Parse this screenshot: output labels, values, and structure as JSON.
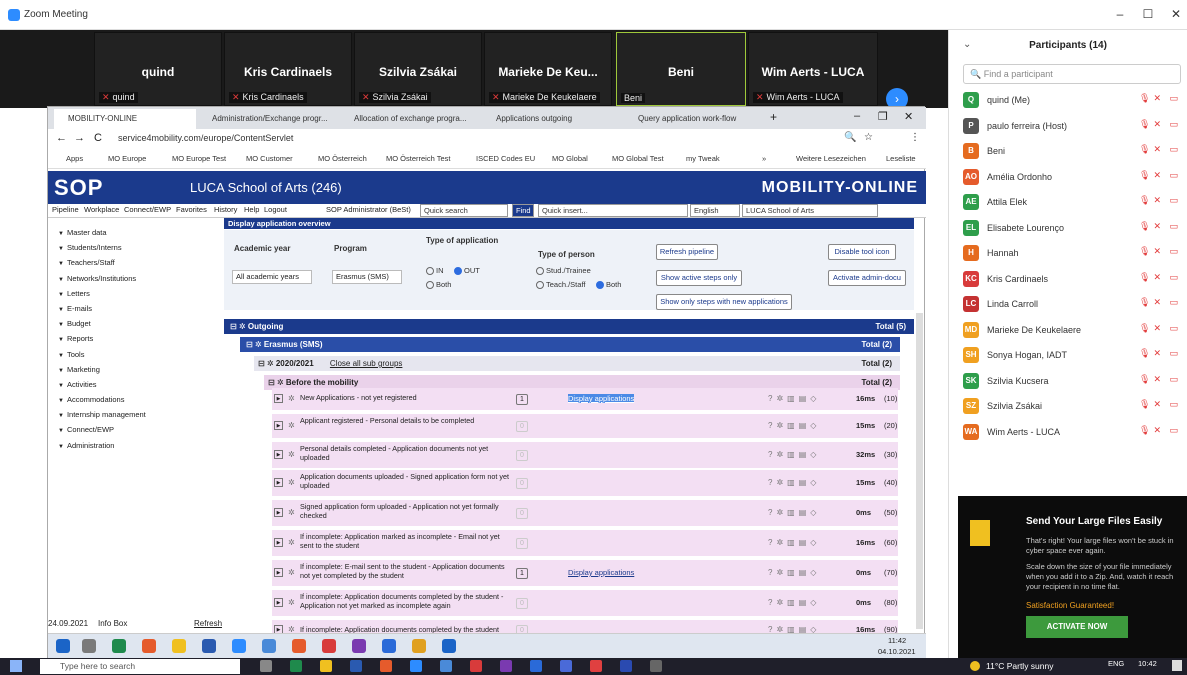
{
  "zoom": {
    "title": "Zoom Meeting"
  },
  "video_strip": {
    "tiles": [
      {
        "big": "quind",
        "small": "quind",
        "muted": true
      },
      {
        "big": "Kris Cardinaels",
        "small": "Kris Cardinaels",
        "muted": true
      },
      {
        "big": "Szilvia Zsákai",
        "small": "Szilvia Zsákai",
        "muted": true
      },
      {
        "big": "Marieke De Keu...",
        "small": "Marieke De Keukelaere",
        "muted": true
      },
      {
        "big": "Beni",
        "small": "Beni",
        "muted": false
      },
      {
        "big": "Wim Aerts - LUCA",
        "small": "Wim Aerts - LUCA",
        "muted": true
      }
    ]
  },
  "participants": {
    "title": "Participants (14)",
    "find_placeholder": "Find a participant",
    "list": [
      {
        "initials": "Q",
        "name": "quind (Me)",
        "color": "#2e9e4b"
      },
      {
        "initials": "P",
        "name": "paulo ferreira (Host)",
        "color": "#555555"
      },
      {
        "initials": "B",
        "name": "Beni",
        "color": "#e56b1f"
      },
      {
        "initials": "AO",
        "name": "Amélia Ordonho",
        "color": "#e55b2c"
      },
      {
        "initials": "AE",
        "name": "Attila Elek",
        "color": "#2e9e4b"
      },
      {
        "initials": "EL",
        "name": "Elisabete Lourenço",
        "color": "#2e9e4b"
      },
      {
        "initials": "H",
        "name": "Hannah",
        "color": "#e56b1f"
      },
      {
        "initials": "KC",
        "name": "Kris Cardinaels",
        "color": "#d83b3b"
      },
      {
        "initials": "LC",
        "name": "Linda Carroll",
        "color": "#c43232"
      },
      {
        "initials": "MD",
        "name": "Marieke De Keukelaere",
        "color": "#f0a020"
      },
      {
        "initials": "SH",
        "name": "Sonya Hogan, IADT",
        "color": "#f0a020"
      },
      {
        "initials": "SK",
        "name": "Szilvia Kucsera",
        "color": "#2e9e4b"
      },
      {
        "initials": "SZ",
        "name": "Szilvia Zsákai",
        "color": "#f0a020"
      },
      {
        "initials": "WA",
        "name": "Wim Aerts - LUCA",
        "color": "#e56b1f"
      }
    ]
  },
  "ad": {
    "title": "Send Your Large Files Easily",
    "text1": "That's right! Your large files won't be stuck in cyber space ever again.",
    "text2": "Scale down the size of your file immediately when you add it to a Zip. And, watch it reach your recipient in no time flat.",
    "satisfaction": "Satisfaction Guaranteed!",
    "button": "ACTIVATE NOW"
  },
  "browser": {
    "tabs": [
      "MOBILITY-ONLINE",
      "Administration/Exchange progr...",
      "Allocation of exchange progra...",
      "Applications outgoing",
      "Query application work-flow"
    ],
    "url": "service4mobility.com/europe/ContentServlet",
    "bookmarks": [
      "Apps",
      "MO Europe",
      "MO Europe Test",
      "MO Customer",
      "MO Österreich",
      "MO Österreich Test",
      "ISCED Codes EU",
      "MO Global",
      "MO Global Test",
      "my Tweak",
      "»",
      "Weitere Lesezeichen",
      "Leseliste"
    ]
  },
  "sop": {
    "logo": "SOP",
    "school": "LUCA School of Arts (246)",
    "brand": "MOBILITY-ONLINE",
    "menu": [
      "Pipeline",
      "Workplace",
      "Connect/EWP",
      "Favorites",
      "History",
      "Help",
      "Logout"
    ],
    "user": "SOP Administrator (BeSt)",
    "quick_search": "Quick search",
    "find": "Find",
    "quick_insert": "Quick insert...",
    "language": "English",
    "institution": "LUCA School of Arts"
  },
  "nav": [
    "Master data",
    "Students/Interns",
    "Teachers/Staff",
    "Networks/Institutions",
    "Letters",
    "E-mails",
    "Budget",
    "Reports",
    "Tools",
    "Marketing",
    "Activities",
    "Accommodations",
    "Internship management",
    "Connect/EWP",
    "Administration"
  ],
  "main": {
    "section_title": "Display application overview",
    "academic_year_label": "Academic year",
    "academic_year_value": "All academic years",
    "program_label": "Program",
    "program_value": "Erasmus (SMS)",
    "type_app_label": "Type of application",
    "type_app_in": "IN",
    "type_app_out": "OUT",
    "type_app_both": "Both",
    "type_person_label": "Type of person",
    "type_person_stud": "Stud./Trainee",
    "type_person_teach": "Teach./Staff",
    "type_person_both": "Both",
    "btn_refresh": "Refresh pipeline",
    "btn_active": "Show active steps only",
    "btn_new": "Show only steps with new applications",
    "btn_disable": "Disable tool icon",
    "btn_admin": "Activate admin-docu",
    "outgoing": "Outgoing",
    "outgoing_total": "Total (5)",
    "erasmus": "Erasmus (SMS)",
    "erasmus_total": "Total (2)",
    "year": "2020/2021",
    "close_sub": "Close all sub groups",
    "year_total": "Total (2)",
    "before": "Before the mobility",
    "before_total": "Total (2)",
    "steps": [
      {
        "text": "New Applications - not yet registered",
        "count": "1",
        "link": "Display applications",
        "hl": true,
        "ms": "16ms",
        "code": "(10)"
      },
      {
        "text": "Applicant registered - Personal details to be completed",
        "count": "0",
        "link": "",
        "hl": false,
        "ms": "15ms",
        "code": "(20)"
      },
      {
        "text": "Personal details completed - Application documents not yet uploaded",
        "count": "0",
        "link": "",
        "hl": false,
        "ms": "32ms",
        "code": "(30)"
      },
      {
        "text": "Application documents uploaded - Signed application form not yet uploaded",
        "count": "0",
        "link": "",
        "hl": false,
        "ms": "15ms",
        "code": "(40)"
      },
      {
        "text": "Signed application form uploaded - Application not yet formally checked",
        "count": "0",
        "link": "",
        "hl": false,
        "ms": "0ms",
        "code": "(50)"
      },
      {
        "text": "If incomplete: Application marked as incomplete - Email not yet sent to the student",
        "count": "0",
        "link": "",
        "hl": false,
        "ms": "16ms",
        "code": "(60)"
      },
      {
        "text": "If incomplete: E-mail sent to the student - Application documents not yet completed by the student",
        "count": "1",
        "link": "Display applications",
        "hl": false,
        "ms": "0ms",
        "code": "(70)"
      },
      {
        "text": "If incomplete: Application documents completed by the student - Application not yet marked as incomplete again",
        "count": "0",
        "link": "",
        "hl": false,
        "ms": "0ms",
        "code": "(80)"
      },
      {
        "text": "If incomplete: Application documents completed by the student",
        "count": "0",
        "link": "",
        "hl": false,
        "ms": "16ms",
        "code": "(90)"
      }
    ]
  },
  "infobar": {
    "date": "24.09.2021",
    "label": "Info Box",
    "refresh": "Refresh"
  },
  "inner_clock": {
    "time": "11:42",
    "date": "04.10.2021"
  },
  "taskbar": {
    "search_placeholder": "Type here to search",
    "weather": "11°C  Partly sunny",
    "lang": "ENG",
    "time": "10:42"
  }
}
